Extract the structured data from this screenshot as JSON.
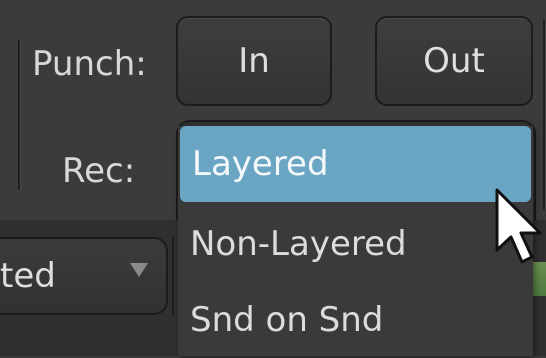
{
  "transport": {
    "punch_label": "Punch:",
    "in_button": "In",
    "out_button": "Out",
    "rec_label": "Rec:"
  },
  "rec_mode": {
    "selected": "Layered",
    "options": [
      "Layered",
      "Non-Layered",
      "Snd on Snd"
    ]
  },
  "lower_combo": {
    "visible_text": "ted"
  },
  "colors": {
    "selection": "#6aa6c4",
    "meter": "#5c8a48"
  }
}
